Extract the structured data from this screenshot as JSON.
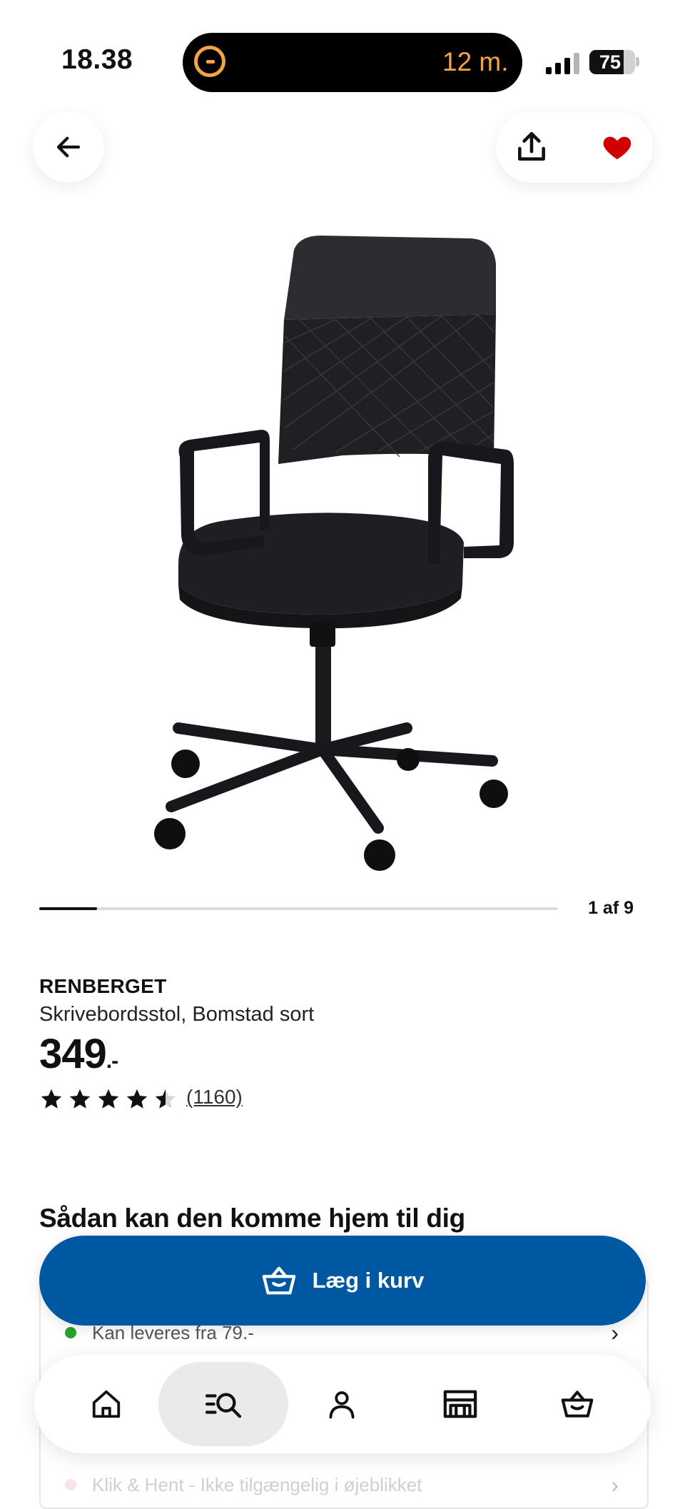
{
  "status_bar": {
    "time": "18.38",
    "activity_text": "12 m.",
    "battery_level": "75",
    "battery_fraction": 0.75,
    "activity_color": "#f5a443"
  },
  "header": {
    "back_icon": "arrow-left-icon",
    "share_icon": "share-icon",
    "favorite_icon": "heart-filled-icon",
    "favorite_color": "#d00000"
  },
  "carousel": {
    "page_indicator": "1 af 9",
    "current": 1,
    "total": 9
  },
  "product": {
    "name": "RENBERGET",
    "description": "Skrivebordsstol, Bomstad sort",
    "price": "349",
    "price_suffix": ".-",
    "rating": 4.5,
    "rating_max": 5,
    "reviews": "(1160)"
  },
  "delivery": {
    "title": "Sådan kan den komme hjem til dig",
    "rows": [
      {
        "text": "Kan leveres fra 79.-",
        "status_color": "#2ca02c"
      },
      {
        "text": "Klik & Hent - Ikke tilgængelig i øjeblikket",
        "status_color": "#e8a0a8"
      }
    ]
  },
  "cart_button": {
    "label": "Læg i kurv",
    "icon": "basket-icon",
    "color": "#0058a3"
  },
  "bottom_nav": {
    "items": [
      {
        "name": "home",
        "icon": "home-icon"
      },
      {
        "name": "search",
        "icon": "search-list-icon",
        "active": true
      },
      {
        "name": "profile",
        "icon": "user-icon"
      },
      {
        "name": "store",
        "icon": "store-icon"
      },
      {
        "name": "cart",
        "icon": "basket-icon"
      }
    ]
  }
}
